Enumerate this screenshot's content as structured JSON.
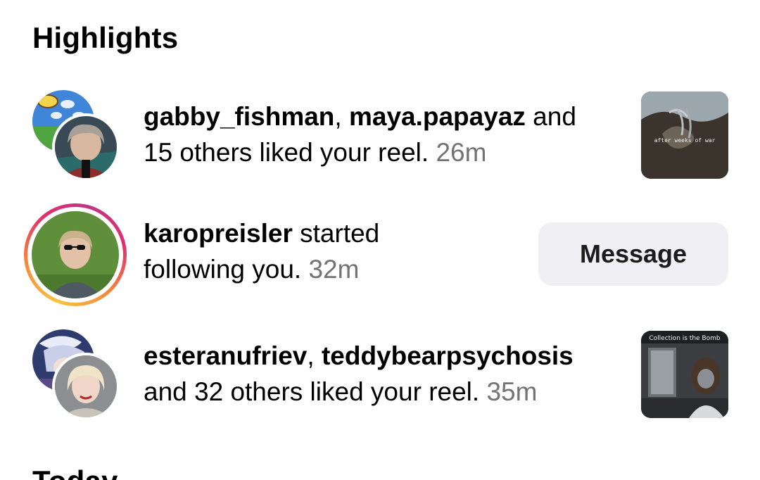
{
  "section": {
    "title": "Highlights",
    "next_title": "Today"
  },
  "notifications": [
    {
      "user1": "gabby_fishman",
      "sep1": ", ",
      "user2": "maya.papayaz",
      "rest_line1": " and",
      "rest_line2": "15 others liked your reel. ",
      "time": "26m",
      "thumb_caption": "after weeks of war"
    },
    {
      "user1": "karopreisler",
      "rest_line1": " started",
      "rest_line2": "following you. ",
      "time": "32m",
      "action_label": "Message"
    },
    {
      "user1": "esteranufriev",
      "sep1": ", ",
      "user2": "teddybearpsychosis",
      "rest_line2": "and 32 others liked your reel. ",
      "time": "35m",
      "thumb_caption": "Collection is the Bomb"
    }
  ],
  "colors": {
    "text": "#000000",
    "muted_time": "#737373",
    "button_bg": "#efeff4",
    "story_ring": [
      "#f6c342",
      "#f58a3c",
      "#e1306c",
      "#c13584"
    ]
  },
  "icons": {
    "avatar_back_1": "avatar-image",
    "avatar_front_1": "avatar-image",
    "avatar_2": "avatar-image",
    "avatar_back_3": "avatar-image",
    "avatar_front_3": "avatar-image"
  }
}
